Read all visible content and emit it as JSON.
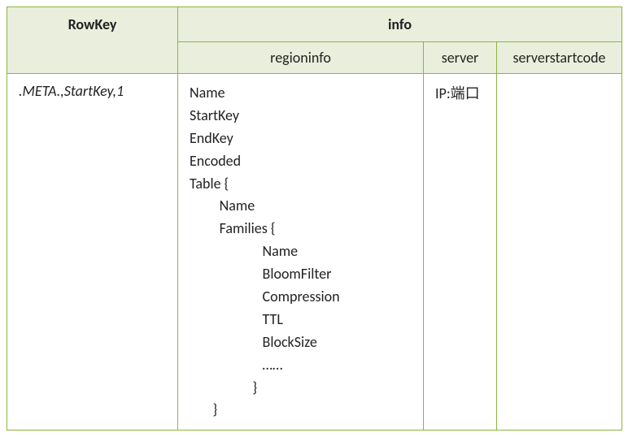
{
  "headers": {
    "rowkey": "RowKey",
    "info": "info",
    "regioninfo": "regioninfo",
    "server": "server",
    "serverstartcode": "serverstartcode"
  },
  "row": {
    "rowkey": ".META.,StartKey,1",
    "regioninfo_text": "Name\nStartKey\nEndKey\nEncoded\nTable {\n         Name\n         Families {\n                      Name\n                      BloomFilter\n                      Compression\n                      TTL\n                      BlockSize\n                      ……\n                   }\n       }",
    "server": "IP:端口",
    "serverstartcode": ""
  }
}
